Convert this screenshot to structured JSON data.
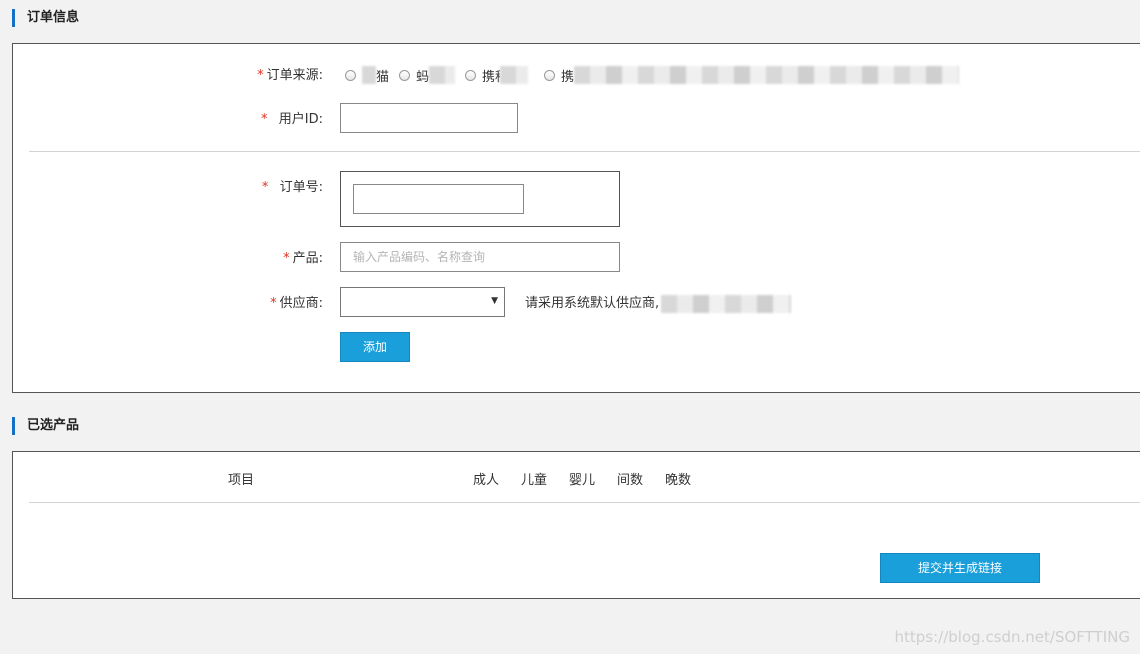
{
  "order_section": {
    "title": "订单信息",
    "source_label": "订单来源:",
    "required_mark": "*",
    "sources": [
      {
        "label": "猫"
      },
      {
        "label": "蚂"
      },
      {
        "label": "携程"
      },
      {
        "label": "携"
      }
    ],
    "user_id_label": "用户ID:",
    "user_id_value": "",
    "order_no_label": "订单号:",
    "order_no_value": "",
    "product_label": "产品:",
    "product_placeholder": "输入产品编码、名称查询",
    "supplier_label": "供应商:",
    "supplier_value": "",
    "supplier_hint": "请采用系统默认供应商,",
    "add_button": "添加"
  },
  "selected_section": {
    "title": "已选产品",
    "columns": [
      "项目",
      "成人",
      "儿童",
      "婴儿",
      "间数",
      "晚数"
    ],
    "submit_button": "提交并生成链接"
  },
  "watermark": "https://blog.csdn.net/SOFTTING"
}
